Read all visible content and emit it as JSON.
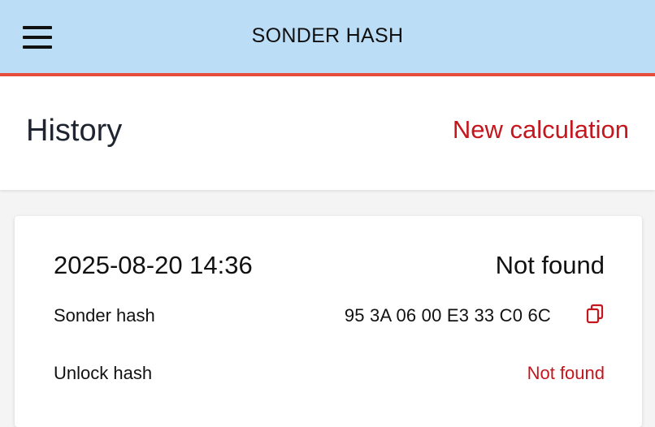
{
  "appbar": {
    "title": "SONDER HASH",
    "menu_icon": "hamburger-menu-icon",
    "background": "#bcddf6",
    "accent_border": "#e74c3c"
  },
  "header": {
    "title": "History",
    "new_calculation_label": "New calculation",
    "link_color": "#c4161c"
  },
  "history": [
    {
      "datetime": "2025-08-20 14:36",
      "status": "Not found",
      "sonder_hash_label": "Sonder hash",
      "sonder_hash_value": "95 3A 06 00 E3 33 C0 6C",
      "copy_icon": "copy-icon",
      "unlock_hash_label": "Unlock hash",
      "unlock_hash_value": "Not found"
    }
  ]
}
